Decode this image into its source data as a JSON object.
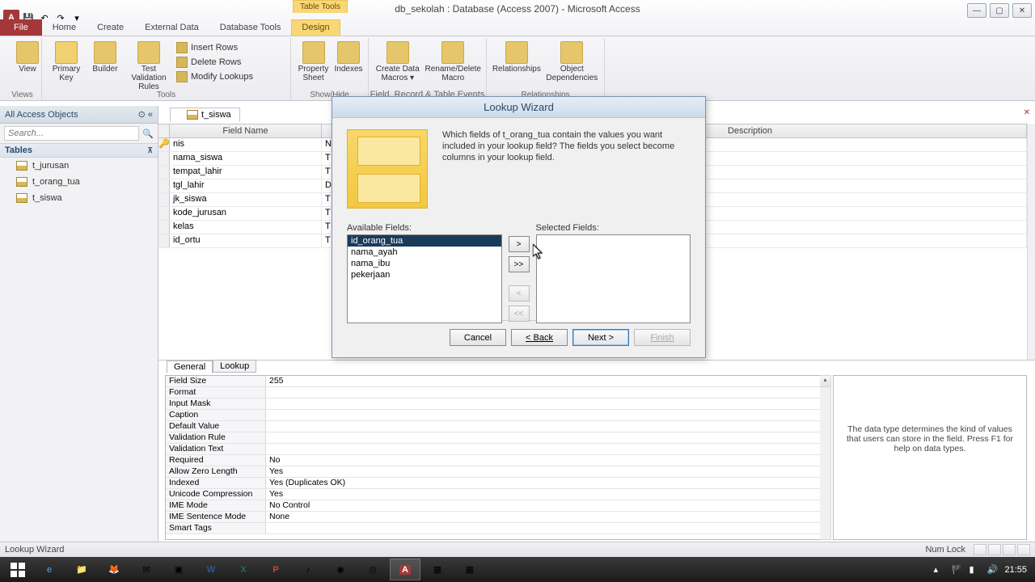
{
  "title": "db_sekolah : Database (Access 2007) - Microsoft Access",
  "table_tools": "Table Tools",
  "tabs": {
    "file": "File",
    "home": "Home",
    "create": "Create",
    "external": "External Data",
    "dbtools": "Database Tools",
    "design": "Design"
  },
  "ribbon": {
    "views": {
      "view": "View",
      "group": "Views"
    },
    "tools": {
      "pk": "Primary Key",
      "builder": "Builder",
      "test": "Test Validation Rules",
      "insert": "Insert Rows",
      "delete": "Delete Rows",
      "modify": "Modify Lookups",
      "group": "Tools"
    },
    "showhide": {
      "prop": "Property Sheet",
      "idx": "Indexes",
      "group": "Show/Hide"
    },
    "events": {
      "cdm": "Create Data Macros ▾",
      "rdm": "Rename/Delete Macro",
      "group": "Field, Record & Table Events"
    },
    "rel": {
      "rel": "Relationships",
      "dep": "Object Dependencies",
      "group": "Relationships"
    }
  },
  "nav": {
    "head": "All Access Objects",
    "search": "Search...",
    "tables_section": "Tables",
    "tables": [
      "t_jurusan",
      "t_orang_tua",
      "t_siswa"
    ]
  },
  "doc_tab": "t_siswa",
  "grid_headers": {
    "field": "Field Name",
    "type": "Data Type",
    "desc": "Description"
  },
  "fields": [
    {
      "name": "nis",
      "type": "N"
    },
    {
      "name": "nama_siswa",
      "type": "T"
    },
    {
      "name": "tempat_lahir",
      "type": "T"
    },
    {
      "name": "tgl_lahir",
      "type": "D"
    },
    {
      "name": "jk_siswa",
      "type": "T"
    },
    {
      "name": "kode_jurusan",
      "type": "T"
    },
    {
      "name": "kelas",
      "type": "T"
    },
    {
      "name": "id_ortu",
      "type": "T"
    }
  ],
  "wizard": {
    "title": "Lookup Wizard",
    "prompt": "Which fields of t_orang_tua contain the values you want included in your lookup field? The fields you select become columns in your lookup field.",
    "avail_label": "Available Fields:",
    "sel_label": "Selected Fields:",
    "available": [
      "id_orang_tua",
      "nama_ayah",
      "nama_ibu",
      "pekerjaan"
    ],
    "btn_add": ">",
    "btn_addall": ">>",
    "btn_rem": "<",
    "btn_remall": "<<",
    "cancel": "Cancel",
    "back": "< Back",
    "next": "Next >",
    "finish": "Finish"
  },
  "props": {
    "tabs": {
      "general": "General",
      "lookup": "Lookup"
    },
    "rows": [
      {
        "k": "Field Size",
        "v": "255"
      },
      {
        "k": "Format",
        "v": ""
      },
      {
        "k": "Input Mask",
        "v": ""
      },
      {
        "k": "Caption",
        "v": ""
      },
      {
        "k": "Default Value",
        "v": ""
      },
      {
        "k": "Validation Rule",
        "v": ""
      },
      {
        "k": "Validation Text",
        "v": ""
      },
      {
        "k": "Required",
        "v": "No"
      },
      {
        "k": "Allow Zero Length",
        "v": "Yes"
      },
      {
        "k": "Indexed",
        "v": "Yes (Duplicates OK)"
      },
      {
        "k": "Unicode Compression",
        "v": "Yes"
      },
      {
        "k": "IME Mode",
        "v": "No Control"
      },
      {
        "k": "IME Sentence Mode",
        "v": "None"
      },
      {
        "k": "Smart Tags",
        "v": ""
      }
    ],
    "help": "The data type determines the kind of values that users can store in the field. Press F1 for help on data types."
  },
  "status": {
    "left": "Lookup Wizard",
    "numlock": "Num Lock"
  },
  "tray": {
    "time": "21:55"
  }
}
